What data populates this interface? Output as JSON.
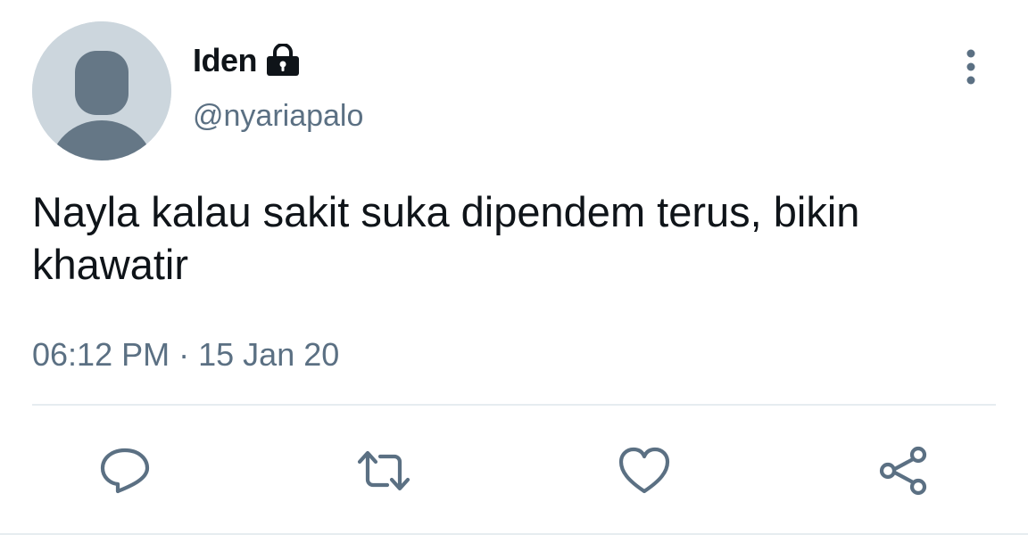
{
  "tweet": {
    "author": {
      "display_name": "Iden",
      "handle": "@nyariapalo",
      "avatar_icon": "default-avatar-icon",
      "protected_icon": "lock-icon"
    },
    "text": "Nayla kalau sakit suka dipendem terus, bikin khawatir",
    "time": "06:12 PM",
    "separator": "·",
    "date": "15 Jan 20"
  },
  "actions": {
    "reply_icon": "reply-icon",
    "retweet_icon": "retweet-icon",
    "like_icon": "like-icon",
    "share_icon": "share-icon",
    "more_icon": "more-vertical-icon"
  },
  "colors": {
    "text_primary": "#0f1419",
    "text_secondary": "#5b7083",
    "icon": "#5b7083",
    "avatar_bg": "#ccd6dd",
    "divider": "#e6ecf0"
  }
}
